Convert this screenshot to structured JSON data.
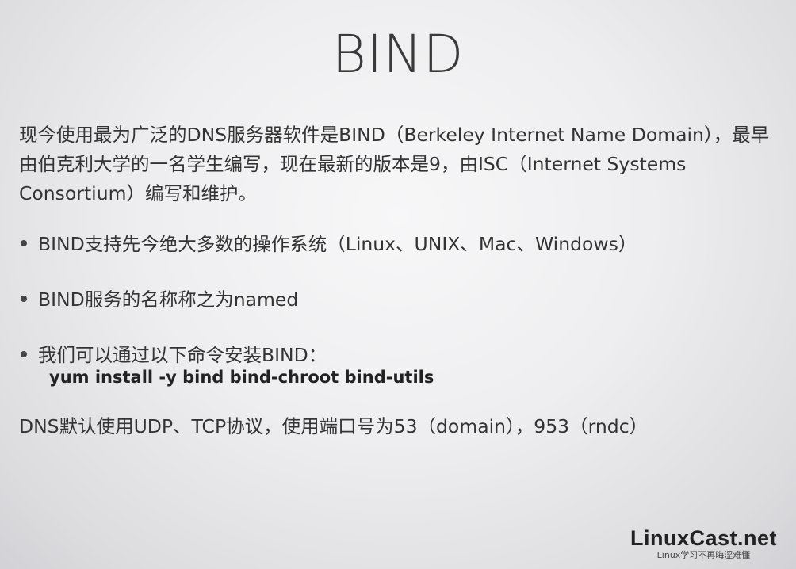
{
  "slide": {
    "title": "BIND",
    "intro": "现今使用最为广泛的DNS服务器软件是BIND（Berkeley Internet Name Domain），最早由伯克利大学的一名学生编写，现在最新的版本是9，由ISC（Internet Systems Consortium）编写和维护。",
    "bullets": [
      "BIND支持先今绝大多数的操作系统（Linux、UNIX、Mac、Windows）",
      "BIND服务的名称称之为named",
      "我们可以通过以下命令安装BIND："
    ],
    "command": "yum install -y bind bind-chroot bind-utils",
    "footer_line": "DNS默认使用UDP、TCP协议，使用端口号为53（domain），953（rndc）"
  },
  "logo": {
    "name": "LinuxCast.net",
    "tagline": "Linux学习不再晦涩难懂"
  }
}
